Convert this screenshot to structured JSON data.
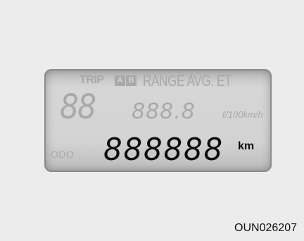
{
  "lcd": {
    "trip_label": "TRIP",
    "trip_a": "A",
    "trip_b": "B",
    "mode_label": "RANGE AVG. ET",
    "segment_large": "88",
    "segment_medium": "888.8",
    "unit_ghost": "ℓ/100km/h",
    "odo_label": "ODO",
    "odometer_digits": "888888",
    "odometer_unit": "km"
  },
  "figure_code": "OUN026207"
}
